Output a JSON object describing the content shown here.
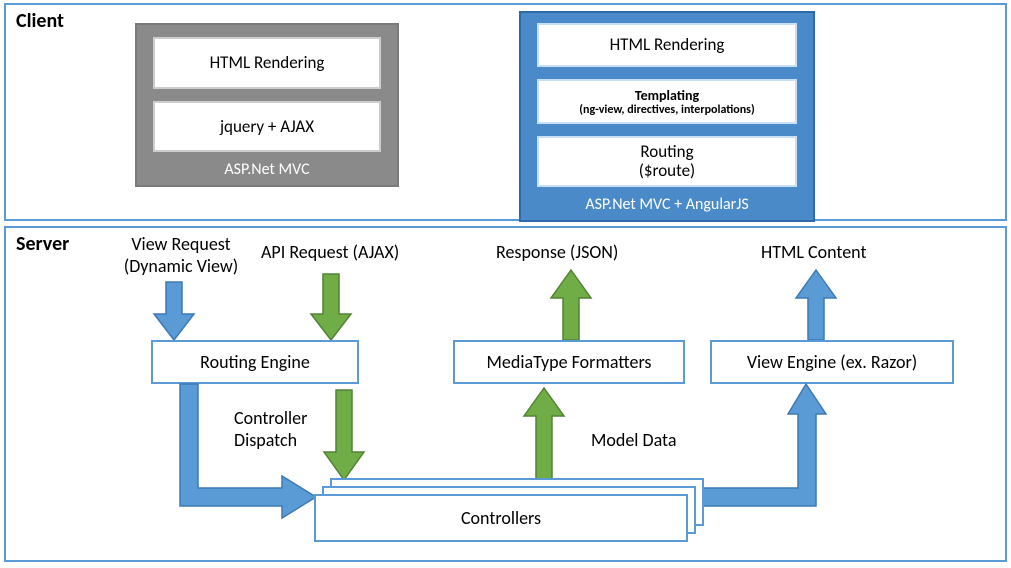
{
  "client": {
    "title": "Client",
    "leftStack": {
      "caption": "ASP.Net MVC",
      "items": [
        "HTML Rendering",
        "jquery + AJAX"
      ]
    },
    "rightStack": {
      "caption": "ASP.Net MVC + AngularJS",
      "items": [
        {
          "title": "HTML Rendering",
          "sub": ""
        },
        {
          "title": "Templating",
          "sub": "(ng-view, directives, interpolations)"
        },
        {
          "title": "Routing",
          "sub": "($route)"
        }
      ]
    }
  },
  "server": {
    "title": "Server",
    "nodes": {
      "routing": "Routing Engine",
      "mediatype": "MediaType Formatters",
      "viewengine": "View Engine (ex. Razor)",
      "controllers": "Controllers"
    },
    "labels": {
      "viewRequest1": "View Request",
      "viewRequest2": "(Dynamic View)",
      "apiRequest": "API Request (AJAX)",
      "response": "Response (JSON)",
      "htmlContent": "HTML Content",
      "controllerDispatch1": "Controller",
      "controllerDispatch2": "Dispatch",
      "modelData": "Model Data"
    }
  },
  "colors": {
    "blue": "#5b9bd5",
    "green": "#70ad47",
    "gray": "#8a8a8a"
  }
}
